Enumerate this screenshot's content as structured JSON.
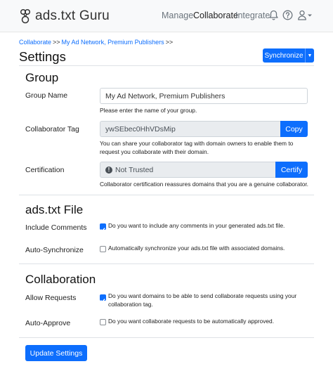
{
  "navbar": {
    "brand": "ads.txt Guru",
    "links": {
      "manage": "Manage",
      "collaborate": "Collaborate",
      "integrate": "Integrate"
    }
  },
  "breadcrumb": {
    "item1": "Collaborate",
    "item2": "My Ad Network, Premium Publishers",
    "sep": ">>"
  },
  "page": {
    "title": "Settings",
    "sync_label": "Synchronize"
  },
  "group": {
    "title": "Group",
    "name_label": "Group Name",
    "name_value": "My Ad Network, Premium Publishers",
    "name_help": "Please enter the name of your group.",
    "tag_label": "Collaborator Tag",
    "tag_value": "ywSEbec0HhVDsMip",
    "tag_button": "Copy",
    "tag_help_1": "You can share your collaborator tag with domain owners to enable them to",
    "tag_help_2": "request you collaborate with their domain.",
    "cert_label": "Certification",
    "cert_value": "Not Trusted",
    "cert_button": "Certify",
    "cert_help": "Collaborator certification reassures domains that you are a genuine collaborator."
  },
  "adstxt": {
    "title": "ads.txt File",
    "comments_label": "Include Comments",
    "comments_text": "Do you want to include any comments in your generated ads.txt file.",
    "comments_checked": true,
    "autosync_label": "Auto-Synchronize",
    "autosync_text": "Automatically synchronize your ads.txt file with associated domains.",
    "autosync_checked": false
  },
  "collaboration": {
    "title": "Collaboration",
    "allow_label": "Allow Requests",
    "allow_text_1": "Do you want domains to be able to send collaborate requests using your",
    "allow_text_2": "collaboration tag.",
    "allow_checked": true,
    "approve_label": "Auto-Approve",
    "approve_text": "Do you want collaborate requests to be automatically approved.",
    "approve_checked": false
  },
  "update_label": "Update Settings",
  "colors": {
    "primary": "#0d6efd",
    "navbar_bg": "#f8f9fa",
    "disabled_bg": "#e9ecef"
  }
}
